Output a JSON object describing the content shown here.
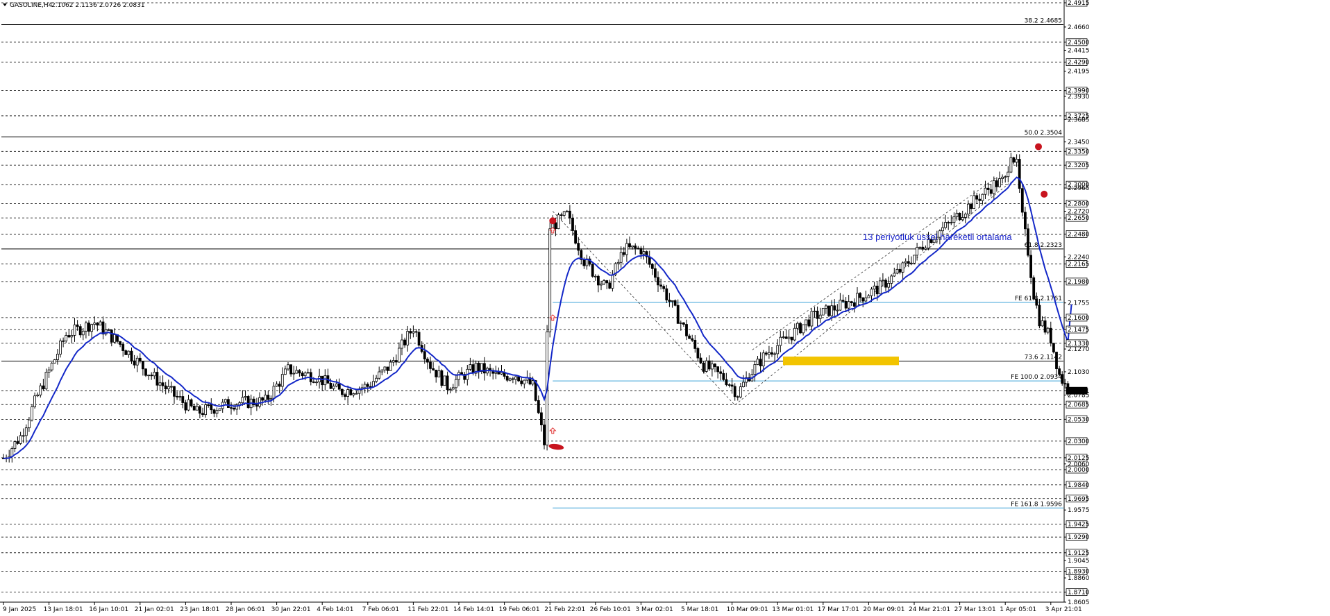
{
  "header": {
    "symbol": "GASOLINE,H4",
    "ohlc": "2.1062 2.1136 2.0726 2.0831"
  },
  "annotation": {
    "text": "13 periyotluk üssel hareketli ortalama"
  },
  "colors": {
    "background": "#ffffff",
    "candle": "#000000",
    "ema": "#1428c8",
    "fib_line": "#000000",
    "fe_line": "#3aa0d8",
    "fe_label": "#3a8fd8",
    "highlight_zone": "#f2c400",
    "marker": "#c8141e",
    "arrow": "#e03030",
    "dashed_grid": "#000000"
  },
  "chart_data": {
    "type": "candlestick",
    "instrument": "GASOLINE",
    "timeframe": "H4",
    "ohlc_last": {
      "open": 2.1062,
      "high": 2.1136,
      "low": 2.0726,
      "close": 2.0831
    },
    "ylim": [
      1.8605,
      2.4915
    ],
    "y_axis_labels": [
      {
        "value": 2.4915,
        "text": "2.4915",
        "boxed": true
      },
      {
        "value": 2.466,
        "text": "2.4660",
        "boxed": false
      },
      {
        "value": 2.45,
        "text": "2.4500",
        "boxed": true
      },
      {
        "value": 2.4415,
        "text": "2.4415",
        "boxed": false
      },
      {
        "value": 2.429,
        "text": "2.4290",
        "boxed": true
      },
      {
        "value": 2.4195,
        "text": "2.4195",
        "boxed": false
      },
      {
        "value": 2.399,
        "text": "2.3990",
        "boxed": true
      },
      {
        "value": 2.393,
        "text": "2.3930",
        "boxed": false
      },
      {
        "value": 2.3725,
        "text": "2.3725",
        "boxed": true
      },
      {
        "value": 2.3685,
        "text": "2.3685",
        "boxed": false
      },
      {
        "value": 2.345,
        "text": "2.3450",
        "boxed": false
      },
      {
        "value": 2.335,
        "text": "2.3350",
        "boxed": true
      },
      {
        "value": 2.3205,
        "text": "2.3205",
        "boxed": true
      },
      {
        "value": 2.3,
        "text": "2.3000",
        "boxed": true
      },
      {
        "value": 2.2965,
        "text": "2.2965",
        "boxed": false
      },
      {
        "value": 2.28,
        "text": "2.2800",
        "boxed": true
      },
      {
        "value": 2.272,
        "text": "2.2720",
        "boxed": false
      },
      {
        "value": 2.265,
        "text": "2.2650",
        "boxed": true
      },
      {
        "value": 2.248,
        "text": "2.2480",
        "boxed": true
      },
      {
        "value": 2.224,
        "text": "2.2240",
        "boxed": false
      },
      {
        "value": 2.2165,
        "text": "2.2165",
        "boxed": true
      },
      {
        "value": 2.198,
        "text": "2.1980",
        "boxed": true
      },
      {
        "value": 2.1755,
        "text": "2.1755",
        "boxed": false
      },
      {
        "value": 2.16,
        "text": "2.1600",
        "boxed": true
      },
      {
        "value": 2.1475,
        "text": "2.1475",
        "boxed": true
      },
      {
        "value": 2.133,
        "text": "2.1330",
        "boxed": true
      },
      {
        "value": 2.127,
        "text": "2.1270",
        "boxed": false
      },
      {
        "value": 2.103,
        "text": "2.1030",
        "boxed": false
      },
      {
        "value": 2.0831,
        "text": "2.0831",
        "boxed": true,
        "dark": true
      },
      {
        "value": 2.0785,
        "text": "2.0785",
        "boxed": false
      },
      {
        "value": 2.0685,
        "text": "2.0685",
        "boxed": true
      },
      {
        "value": 2.053,
        "text": "2.0530",
        "boxed": true
      },
      {
        "value": 2.03,
        "text": "2.0300",
        "boxed": true
      },
      {
        "value": 2.0125,
        "text": "2.0125",
        "boxed": true
      },
      {
        "value": 2.006,
        "text": "2.0060",
        "boxed": false
      },
      {
        "value": 2.0,
        "text": "2.0000",
        "boxed": true
      },
      {
        "value": 1.984,
        "text": "1.9840",
        "boxed": true
      },
      {
        "value": 1.9695,
        "text": "1.9695",
        "boxed": true
      },
      {
        "value": 1.9575,
        "text": "1.9575",
        "boxed": false
      },
      {
        "value": 1.9425,
        "text": "1.9425",
        "boxed": true
      },
      {
        "value": 1.929,
        "text": "1.9290",
        "boxed": true
      },
      {
        "value": 1.9125,
        "text": "1.9125",
        "boxed": true
      },
      {
        "value": 1.9045,
        "text": "1.9045",
        "boxed": false
      },
      {
        "value": 1.893,
        "text": "1.8930",
        "boxed": true
      },
      {
        "value": 1.886,
        "text": "1.8860",
        "boxed": false
      },
      {
        "value": 1.871,
        "text": "1.8710",
        "boxed": true
      },
      {
        "value": 1.8605,
        "text": "1.8605",
        "boxed": false
      }
    ],
    "dashed_levels": [
      2.4915,
      2.45,
      2.429,
      2.399,
      2.3725,
      2.335,
      2.3205,
      2.3,
      2.28,
      2.265,
      2.248,
      2.2165,
      2.198,
      2.16,
      2.1475,
      2.133,
      2.0831,
      2.0685,
      2.053,
      2.03,
      2.0125,
      2.0,
      1.984,
      1.9695,
      1.9425,
      1.929,
      1.9125,
      1.893,
      1.871
    ],
    "fib_levels": [
      {
        "label": "38.2 2.4685",
        "value": 2.4685
      },
      {
        "label": "50.0 2.3504",
        "value": 2.3504
      },
      {
        "label": "61.8 2.2323",
        "value": 2.2323
      },
      {
        "label": "73.6 2.1142",
        "value": 2.1142
      }
    ],
    "fe_levels": [
      {
        "label": "FE 61.8 2.1761",
        "value": 2.1761
      },
      {
        "label": "FE 100.0 2.0934",
        "value": 2.0934
      },
      {
        "label": "FE 161.8 1.9596",
        "value": 1.9596
      }
    ],
    "x_labels": [
      "9 Jan 2025",
      "13 Jan 18:01",
      "16 Jan 10:01",
      "21 Jan 02:01",
      "23 Jan 18:01",
      "28 Jan 06:01",
      "30 Jan 22:01",
      "4 Feb 14:01",
      "7 Feb 06:01",
      "11 Feb 22:01",
      "14 Feb 14:01",
      "19 Feb 06:01",
      "21 Feb 22:01",
      "26 Feb 10:01",
      "3 Mar 02:01",
      "5 Mar 18:01",
      "10 Mar 09:01",
      "13 Mar 01:01",
      "17 Mar 17:01",
      "20 Mar 09:01",
      "24 Mar 21:01",
      "27 Mar 13:01",
      "1 Apr 05:01",
      "3 Apr 21:01"
    ],
    "x_label_bar_index": [
      0,
      16,
      32,
      48,
      64,
      80,
      96,
      112,
      128,
      144,
      160,
      176,
      192,
      208,
      224,
      240,
      256,
      272,
      288,
      304,
      320,
      336,
      352,
      368
    ],
    "bar_count": 375,
    "price_path_anchors": [
      [
        0,
        2.012
      ],
      [
        6,
        2.035
      ],
      [
        12,
        2.078
      ],
      [
        22,
        2.142
      ],
      [
        32,
        2.155
      ],
      [
        40,
        2.135
      ],
      [
        50,
        2.105
      ],
      [
        60,
        2.078
      ],
      [
        68,
        2.06
      ],
      [
        80,
        2.07
      ],
      [
        92,
        2.072
      ],
      [
        100,
        2.105
      ],
      [
        110,
        2.098
      ],
      [
        118,
        2.082
      ],
      [
        128,
        2.088
      ],
      [
        136,
        2.11
      ],
      [
        144,
        2.15
      ],
      [
        150,
        2.11
      ],
      [
        156,
        2.088
      ],
      [
        166,
        2.108
      ],
      [
        174,
        2.098
      ],
      [
        180,
        2.1
      ],
      [
        186,
        2.088
      ],
      [
        190,
        2.028
      ],
      [
        192,
        2.255
      ],
      [
        198,
        2.268
      ],
      [
        204,
        2.22
      ],
      [
        212,
        2.19
      ],
      [
        218,
        2.232
      ],
      [
        224,
        2.232
      ],
      [
        230,
        2.2
      ],
      [
        238,
        2.155
      ],
      [
        246,
        2.11
      ],
      [
        254,
        2.095
      ],
      [
        258,
        2.08
      ],
      [
        262,
        2.1
      ],
      [
        268,
        2.122
      ],
      [
        276,
        2.14
      ],
      [
        284,
        2.16
      ],
      [
        292,
        2.17
      ],
      [
        300,
        2.18
      ],
      [
        308,
        2.192
      ],
      [
        316,
        2.212
      ],
      [
        324,
        2.24
      ],
      [
        332,
        2.258
      ],
      [
        340,
        2.28
      ],
      [
        348,
        2.3
      ],
      [
        352,
        2.305
      ],
      [
        354,
        2.335
      ],
      [
        356,
        2.32
      ],
      [
        358,
        2.265
      ],
      [
        360,
        2.23
      ],
      [
        362,
        2.185
      ],
      [
        364,
        2.158
      ],
      [
        368,
        2.138
      ],
      [
        371,
        2.1
      ],
      [
        374,
        2.083
      ]
    ],
    "ema_period": 13,
    "ema_extension_end": [
      376,
      2.174
    ],
    "highlight_zone": {
      "bar_from": 341,
      "bar_to": 392,
      "y_from": 2.11,
      "y_to": 2.119
    },
    "trendline_pattern": [
      [
        193,
        2.272
      ],
      [
        257,
        2.068
      ],
      [
        354,
        2.303
      ]
    ],
    "markers": [
      {
        "bar": 193,
        "value": 2.262
      },
      {
        "bar": 193,
        "value": 2.024,
        "shape": "smear"
      },
      {
        "bar": 360,
        "value": 2.34
      },
      {
        "bar": 362,
        "value": 2.29
      }
    ],
    "arrows": [
      {
        "bar": 193,
        "value": 2.252
      },
      {
        "bar": 193,
        "value": 2.16
      },
      {
        "bar": 193,
        "value": 2.041
      }
    ]
  }
}
